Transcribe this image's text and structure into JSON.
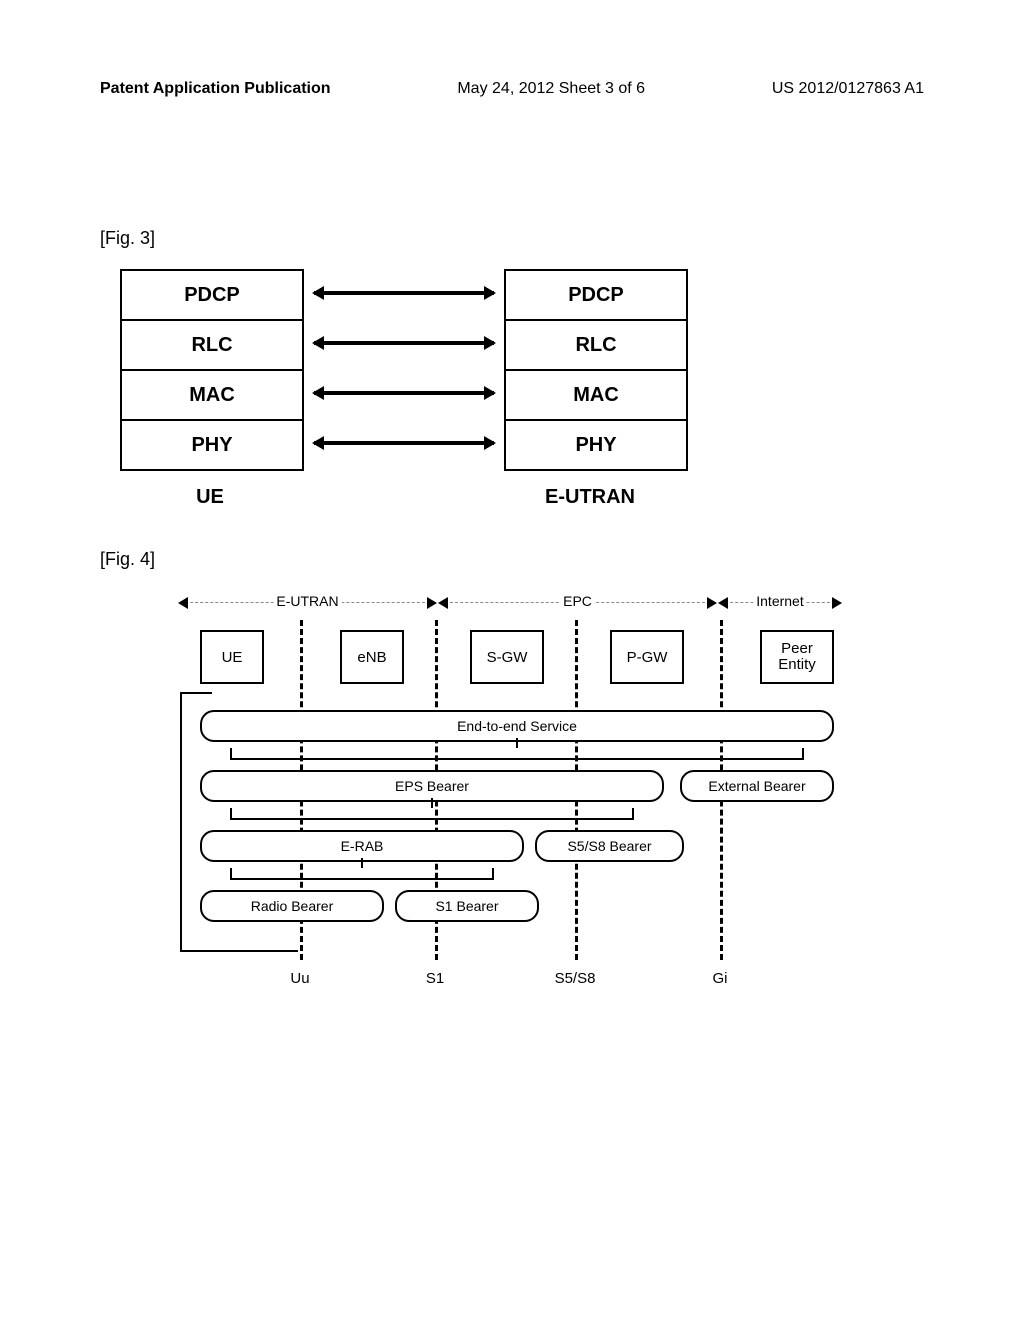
{
  "header": {
    "left": "Patent Application Publication",
    "center": "May 24, 2012  Sheet 3 of 6",
    "right": "US 2012/0127863 A1"
  },
  "fig3": {
    "label": "[Fig. 3]",
    "layers": [
      "PDCP",
      "RLC",
      "MAC",
      "PHY"
    ],
    "col_left": "UE",
    "col_right": "E-UTRAN"
  },
  "fig4": {
    "label": "[Fig. 4]",
    "segments": {
      "eutran": "E-UTRAN",
      "epc": "EPC",
      "internet": "Internet"
    },
    "nodes": {
      "ue": "UE",
      "enb": "eNB",
      "sgw": "S-GW",
      "pgw": "P-GW",
      "peer": "Peer\nEntity"
    },
    "bearers": {
      "e2e": "End-to-end Service",
      "eps": "EPS Bearer",
      "ext": "External Bearer",
      "erab": "E-RAB",
      "s5s8b": "S5/S8 Bearer",
      "radio": "Radio Bearer",
      "s1b": "S1 Bearer"
    },
    "interfaces": {
      "uu": "Uu",
      "s1": "S1",
      "s5s8": "S5/S8",
      "gi": "Gi"
    }
  },
  "chart_data": [
    {
      "type": "diagram",
      "title": "Fig. 3 — User-plane protocol stack UE ↔ E-UTRAN",
      "ue_stack": [
        "PDCP",
        "RLC",
        "MAC",
        "PHY"
      ],
      "eutran_stack": [
        "PDCP",
        "RLC",
        "MAC",
        "PHY"
      ],
      "peer_links": [
        [
          "UE.PDCP",
          "E-UTRAN.PDCP"
        ],
        [
          "UE.RLC",
          "E-UTRAN.RLC"
        ],
        [
          "UE.MAC",
          "E-UTRAN.MAC"
        ],
        [
          "UE.PHY",
          "E-UTRAN.PHY"
        ]
      ]
    },
    {
      "type": "diagram",
      "title": "Fig. 4 — EPS bearer service architecture",
      "domains": {
        "E-UTRAN": [
          "UE",
          "eNB"
        ],
        "EPC": [
          "S-GW",
          "P-GW"
        ],
        "Internet": [
          "Peer Entity"
        ]
      },
      "interfaces": {
        "Uu": [
          "UE",
          "eNB"
        ],
        "S1": [
          "eNB",
          "S-GW"
        ],
        "S5/S8": [
          "S-GW",
          "P-GW"
        ],
        "Gi": [
          "P-GW",
          "Peer Entity"
        ]
      },
      "bearers": {
        "End-to-end Service": [
          "UE",
          "Peer Entity"
        ],
        "EPS Bearer": [
          "UE",
          "P-GW"
        ],
        "External Bearer": [
          "P-GW",
          "Peer Entity"
        ],
        "E-RAB": [
          "UE",
          "S-GW"
        ],
        "S5/S8 Bearer": [
          "S-GW",
          "P-GW"
        ],
        "Radio Bearer": [
          "UE",
          "eNB"
        ],
        "S1 Bearer": [
          "eNB",
          "S-GW"
        ]
      },
      "composition": {
        "End-to-end Service": [
          "EPS Bearer",
          "External Bearer"
        ],
        "EPS Bearer": [
          "E-RAB",
          "S5/S8 Bearer"
        ],
        "E-RAB": [
          "Radio Bearer",
          "S1 Bearer"
        ]
      }
    }
  ]
}
